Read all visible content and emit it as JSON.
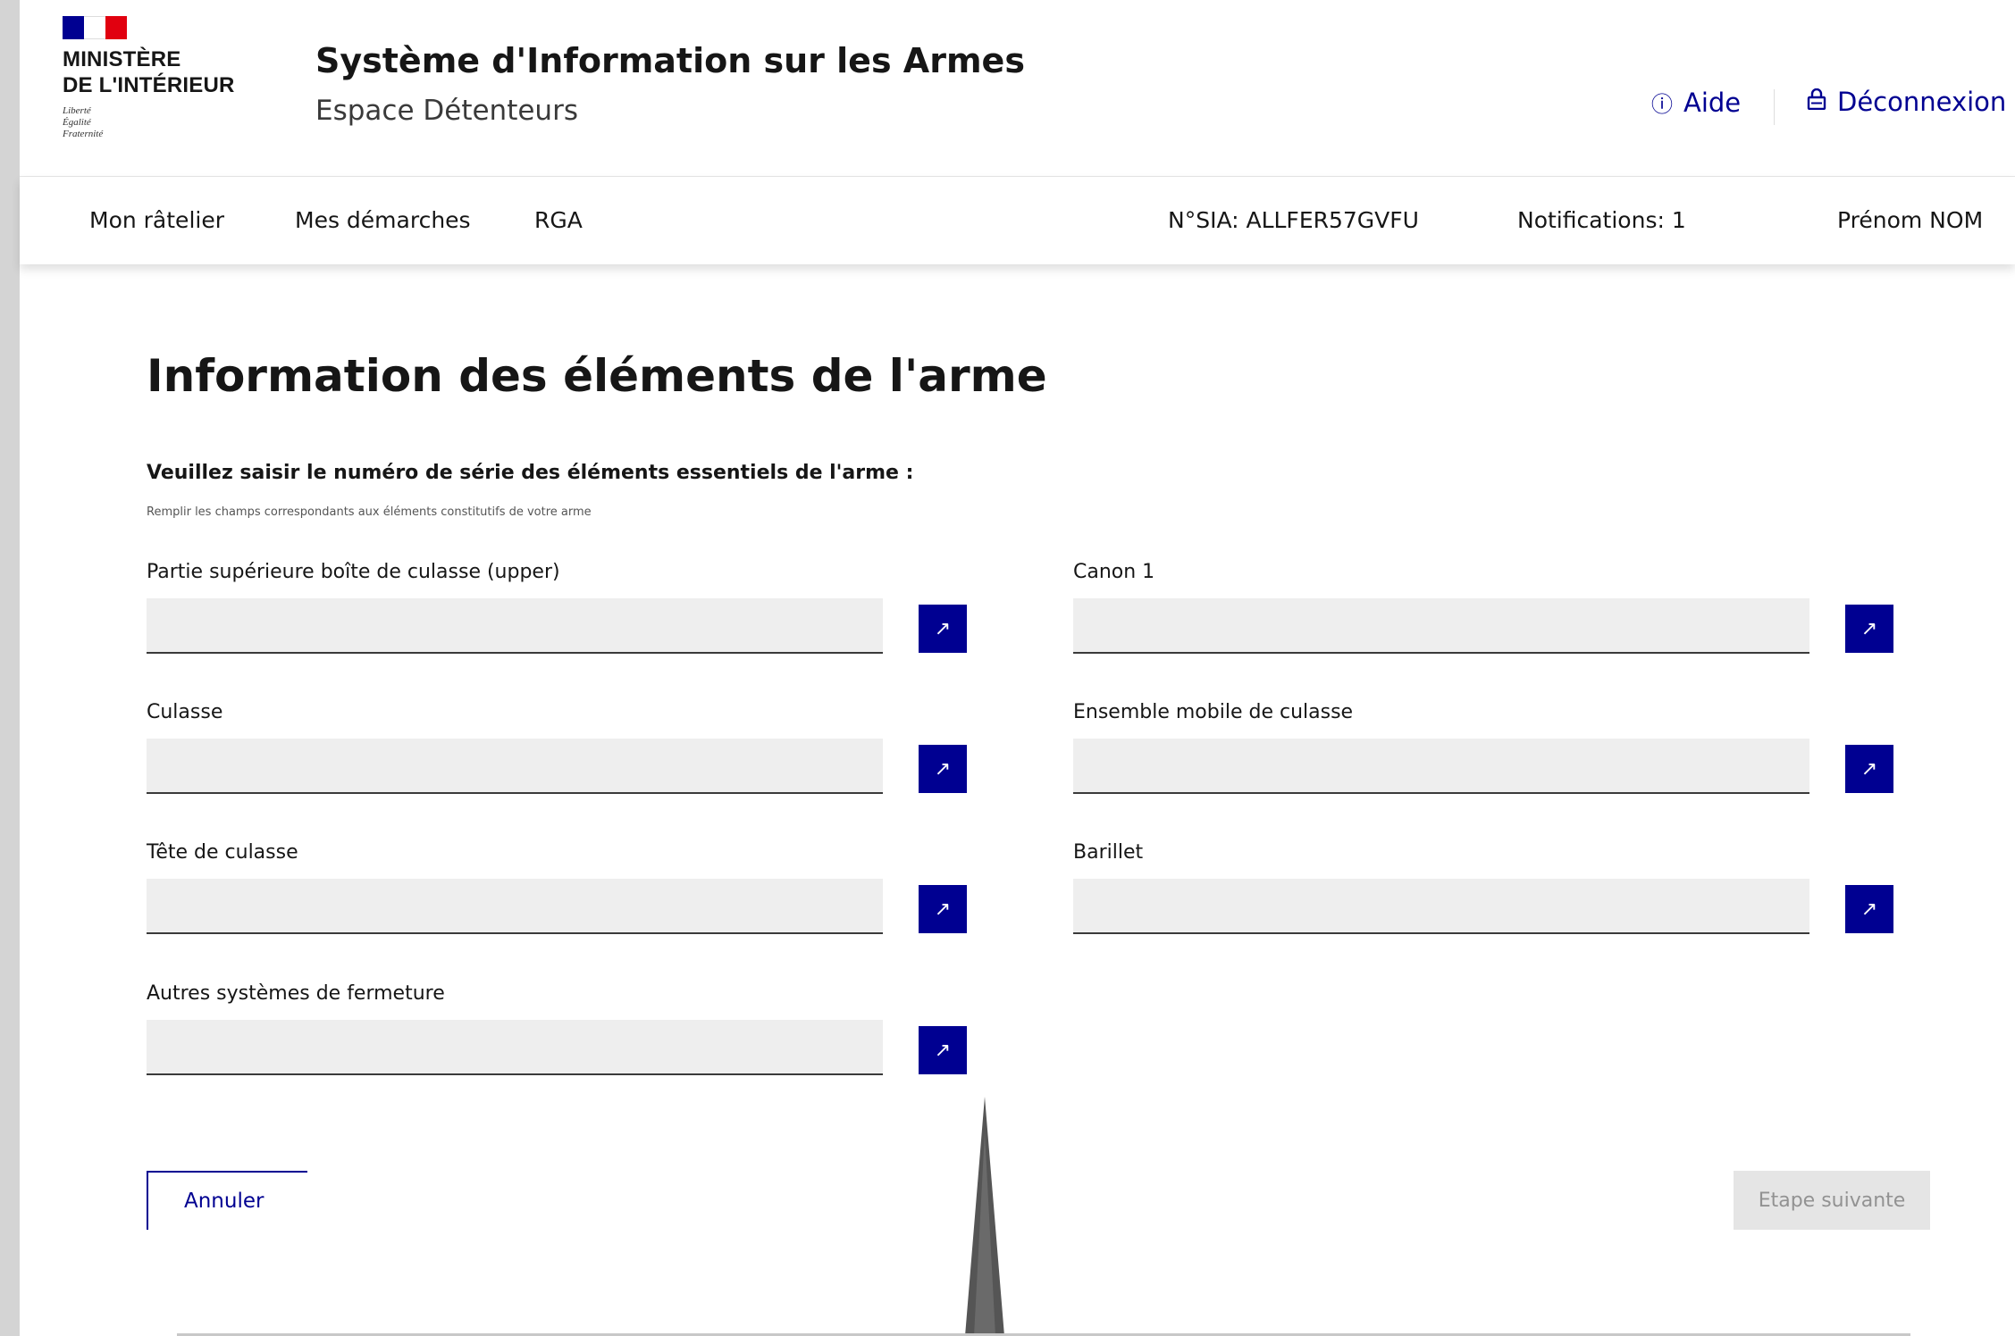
{
  "header": {
    "ministry_line1": "MINISTÈRE",
    "ministry_line2": "DE L'INTÉRIEUR",
    "devise": [
      "Liberté",
      "Égalité",
      "Fraternité"
    ],
    "site_title": "Système d'Information sur les Armes",
    "site_subtitle": "Espace Détenteurs",
    "help_label": "Aide",
    "logout_label": "Déconnexion",
    "colors": {
      "blue": "#000091",
      "red": "#e1000f"
    }
  },
  "nav": {
    "items": [
      "Mon râtelier",
      "Mes démarches",
      "RGA"
    ],
    "sia_number": "N°SIA: ALLFER57GVFU",
    "notifications": "Notifications: 1",
    "user_name": "Prénom NOM"
  },
  "main": {
    "title": "Information des éléments de l'arme",
    "instruction": "Veuillez saisir le numéro de série des éléments essentiels de l'arme :",
    "hint": "Remplir les champs correspondants aux éléments constitutifs de votre arme",
    "fields": [
      {
        "label": "Partie supérieure boîte de culasse (upper)",
        "value": ""
      },
      {
        "label": "Canon 1",
        "value": ""
      },
      {
        "label": "Culasse",
        "value": ""
      },
      {
        "label": "Ensemble mobile de culasse",
        "value": ""
      },
      {
        "label": "Tête de culasse",
        "value": ""
      },
      {
        "label": "Barillet",
        "value": ""
      },
      {
        "label": "Autres systèmes de fermeture",
        "value": ""
      }
    ],
    "cancel_label": "Annuler",
    "next_label": "Etape suivante"
  }
}
